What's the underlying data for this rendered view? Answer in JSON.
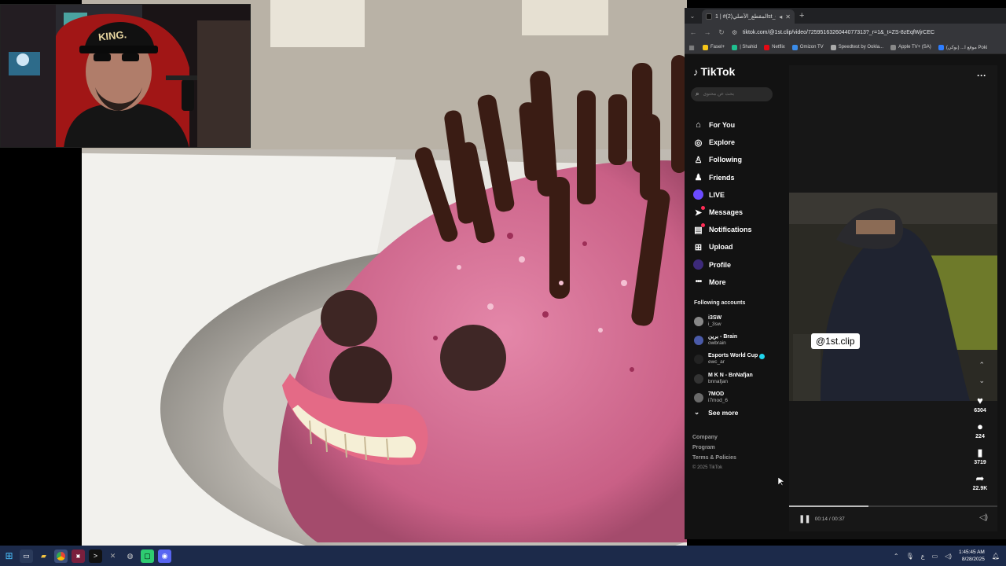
{
  "browser": {
    "tab_title": "‪#المقطع_الأصلي(2)‬‏ | 1st_clip",
    "url": "tiktok.com/@1st.clip/video/7259516326044077313?_r=1&_t=ZS-8zEqfWjrCEC",
    "bookmarks": [
      {
        "label": "Fasel+",
        "color": "#f5c518"
      },
      {
        "label": "| Shahid",
        "color": "#1fbf8f"
      },
      {
        "label": "Netflix",
        "color": "#e50914"
      },
      {
        "label": "Omizon TV",
        "color": "#3a8be8"
      },
      {
        "label": "Speedtest by Ookla...",
        "color": "#aaaaaa"
      },
      {
        "label": "Apple TV+ (SA)",
        "color": "#888888"
      },
      {
        "label": "موقع ا... (بوكي) Poki",
        "color": "#2d7dff"
      }
    ]
  },
  "tiktok": {
    "logo_text": "TikTok",
    "search_placeholder": "بحث عن محتوى",
    "nav": [
      {
        "label": "For You",
        "icon": "home-icon"
      },
      {
        "label": "Explore",
        "icon": "compass-icon"
      },
      {
        "label": "Following",
        "icon": "following-icon"
      },
      {
        "label": "Friends",
        "icon": "friends-icon"
      },
      {
        "label": "LIVE",
        "icon": "live-icon"
      },
      {
        "label": "Messages",
        "icon": "messages-icon"
      },
      {
        "label": "Notifications",
        "icon": "notifications-icon"
      },
      {
        "label": "Upload",
        "icon": "upload-icon"
      },
      {
        "label": "Profile",
        "icon": "profile-icon"
      },
      {
        "label": "More",
        "icon": "more-icon"
      }
    ],
    "following_title": "Following accounts",
    "following": [
      {
        "name": "i3SW",
        "handle": "i_3sw",
        "color": "#888888",
        "verified": false
      },
      {
        "name": "برين - Brain",
        "handle": "owbrain",
        "color": "#4a5aa8",
        "verified": false
      },
      {
        "name": "Esports World Cup",
        "handle": "ewc_ar",
        "color": "#222222",
        "verified": true
      },
      {
        "name": "M K N - BnNafjan",
        "handle": "bnnafjan",
        "color": "#333333",
        "verified": false
      },
      {
        "name": "7MOD",
        "handle": "i7mod_6",
        "color": "#6a6a6a",
        "verified": false
      }
    ],
    "see_more": "See more",
    "footer": [
      "Company",
      "Program",
      "Terms & Policies"
    ],
    "copyright": "© 2025 TikTok",
    "video": {
      "tag": "@1st.clip",
      "likes": "6304",
      "comments": "224",
      "saves": "3719",
      "shares": "22.9K",
      "time": "00:14 / 00:37",
      "progress": 0.38
    }
  },
  "taskbar": {
    "time": "1:45:45 AM",
    "date": "8/28/2025",
    "lang": "ع"
  },
  "webcam": {
    "cap_text": "KING."
  }
}
